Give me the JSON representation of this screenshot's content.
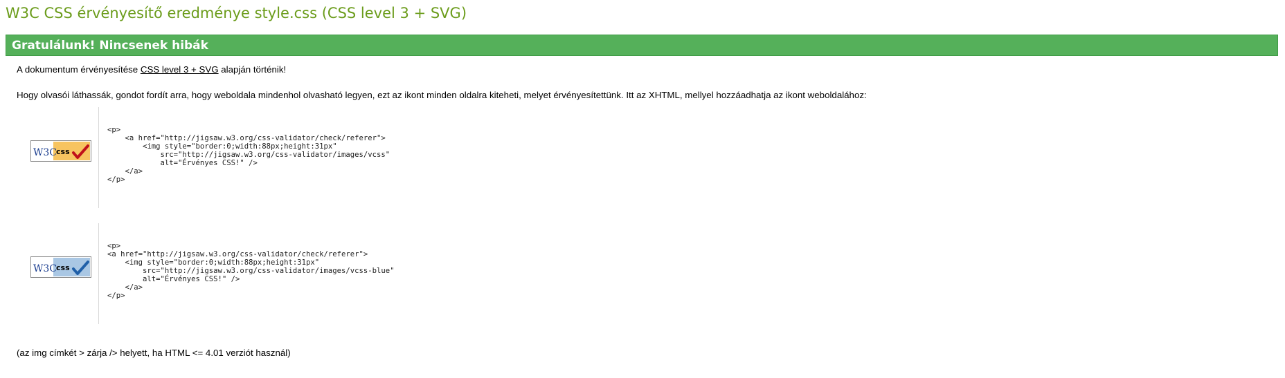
{
  "title": "W3C CSS érvényesítő eredménye style.css (CSS level 3 + SVG)",
  "banner": "Gratulálunk! Nincsenek hibák",
  "validated": {
    "prefix": "A dokumentum érvényesítése ",
    "link": "CSS level 3 + SVG",
    "suffix": " alapján történik!"
  },
  "info": "Hogy olvasói láthassák, gondot fordít arra, hogy weboldala mindenhol olvasható legyen, ezt az ikont minden oldalra kiteheti, melyet érvényesítettünk. Itt az XHTML, mellyel hozzáadhatja az ikont weboldalához:",
  "badges": [
    {
      "logo_w3c": "W3C",
      "logo_css": "css",
      "accent": "#F7C460",
      "check_color": "#C0101A",
      "code": "<p>\n    <a href=\"http://jigsaw.w3.org/css-validator/check/referer\">\n        <img style=\"border:0;width:88px;height:31px\"\n            src=\"http://jigsaw.w3.org/css-validator/images/vcss\"\n            alt=\"Érvényes CSS!\" />\n    </a>\n</p>"
    },
    {
      "logo_w3c": "W3C",
      "logo_css": "css",
      "accent": "#A9C7E4",
      "check_color": "#1F5FA8",
      "code": "<p>\n<a href=\"http://jigsaw.w3.org/css-validator/check/referer\">\n    <img style=\"border:0;width:88px;height:31px\"\n        src=\"http://jigsaw.w3.org/css-validator/images/vcss-blue\"\n        alt=\"Érvényes CSS!\" />\n    </a>\n</p>"
    }
  ],
  "note": "(az img címkét > zárja /> helyett, ha HTML <= 4.01 verziót használ)",
  "colors": {
    "title": "#6B9C1B",
    "banner_bg": "#55B05A",
    "banner_text": "#FFFFFF"
  }
}
